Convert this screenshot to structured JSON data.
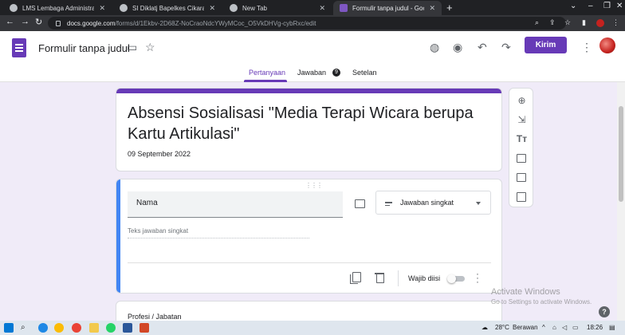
{
  "browser": {
    "tabs": [
      {
        "title": "LMS Lembaga Administrasi Negar",
        "active": false,
        "color": "#d9d9d9"
      },
      {
        "title": "SI Diklatj Bapelkes Cikarang",
        "active": false,
        "color": "#d9d9d9"
      },
      {
        "title": "New Tab",
        "active": false,
        "color": "#d9d9d9"
      },
      {
        "title": "Formulir tanpa judul - Google Fo",
        "active": true,
        "color": "#7e57c2"
      }
    ],
    "url_host": "docs.google.com",
    "url_path": "/forms/d/1Ekbv-2D68Z-NoCraoNdcYWyMCoc_O5VkDHVg-cybRxc/edit"
  },
  "forms": {
    "doc_title": "Formulir tanpa judul",
    "send_label": "Kirim",
    "tabs": [
      "Pertanyaan",
      "Jawaban",
      "Setelan"
    ],
    "responses_count": "9",
    "accent": "#673ab7"
  },
  "title_card": {
    "title": "Absensi Sosialisasi \"Media Terapi Wicara berupa Kartu Artikulasi\"",
    "description": "09 September 2022"
  },
  "question_card": {
    "question": "Nama",
    "type": "Jawaban singkat",
    "answer_placeholder": "Teks jawaban singkat",
    "required_label": "Wajib diisi",
    "accent": "#4285f4"
  },
  "next_card": {
    "question": "Profesi / Jabatan"
  },
  "side_toolbar": [
    "add-question",
    "import-questions",
    "add-title",
    "add-image",
    "add-video",
    "add-section"
  ],
  "watermark": {
    "line1": "Activate Windows",
    "line2": "Go to Settings to activate Windows."
  },
  "taskbar": {
    "temperature": "28°C",
    "weather": "Berawan",
    "time": "18:26"
  }
}
